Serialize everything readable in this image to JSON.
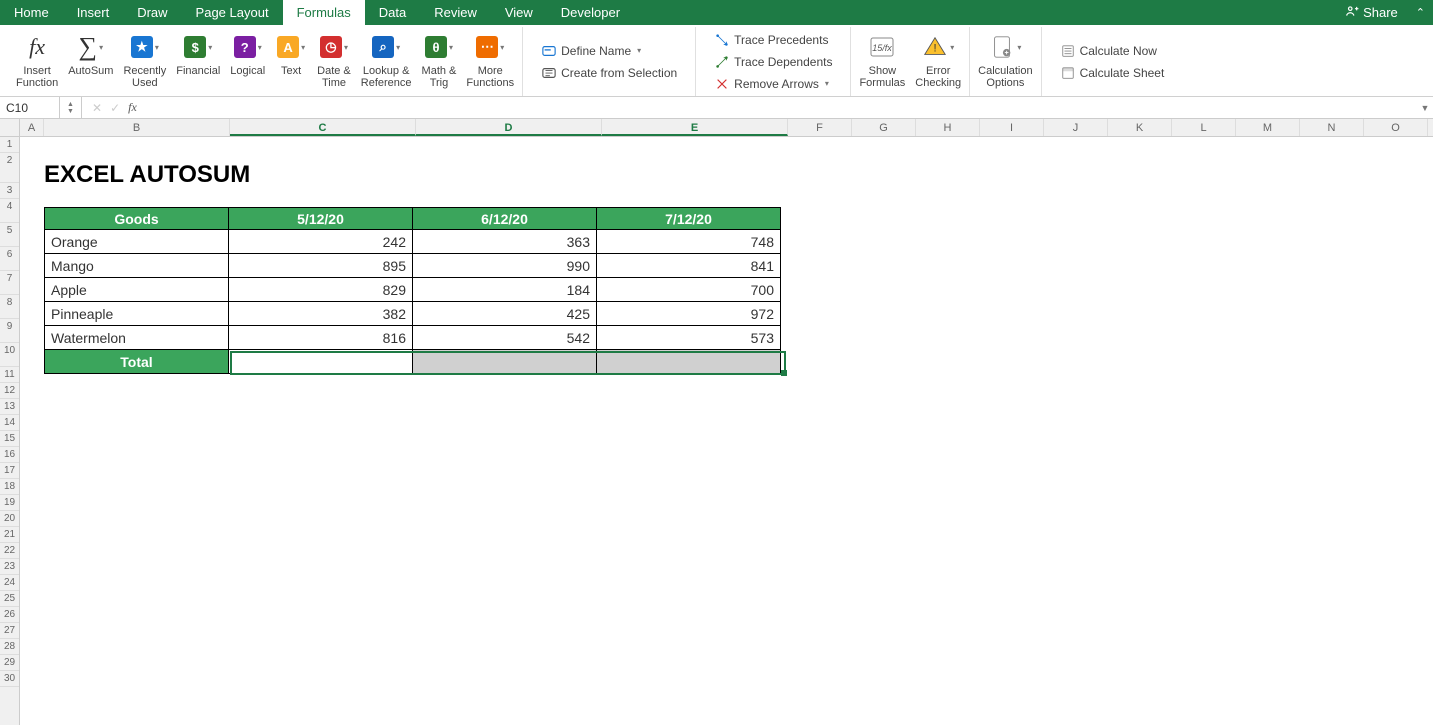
{
  "menu": {
    "tabs": [
      "Home",
      "Insert",
      "Draw",
      "Page Layout",
      "Formulas",
      "Data",
      "Review",
      "View",
      "Developer"
    ],
    "active": 4,
    "share": "Share"
  },
  "ribbon": {
    "insert_function": "Insert\nFunction",
    "autosum": "AutoSum",
    "recently": "Recently\nUsed",
    "financial": "Financial",
    "logical": "Logical",
    "text": "Text",
    "datetime": "Date &\nTime",
    "lookup": "Lookup &\nReference",
    "math": "Math &\nTrig",
    "more": "More\nFunctions",
    "define_name": "Define Name",
    "create_sel": "Create from Selection",
    "trace_prec": "Trace Precedents",
    "trace_dep": "Trace Dependents",
    "remove_arrows": "Remove Arrows",
    "show_formulas": "Show\nFormulas",
    "error_check": "Error\nChecking",
    "calc_options": "Calculation\nOptions",
    "calc_now": "Calculate Now",
    "calc_sheet": "Calculate Sheet"
  },
  "namebox": "C10",
  "cols": [
    "A",
    "B",
    "C",
    "D",
    "E",
    "F",
    "G",
    "H",
    "I",
    "J",
    "K",
    "L",
    "M",
    "N",
    "O"
  ],
  "selectedCols": [
    "C",
    "D",
    "E"
  ],
  "rows": 30,
  "sheet": {
    "title": "EXCEL AUTOSUM",
    "headers": [
      "Goods",
      "5/12/20",
      "6/12/20",
      "7/12/20"
    ],
    "data": [
      {
        "g": "Orange",
        "c": 242,
        "d": 363,
        "e": 748
      },
      {
        "g": "Mango",
        "c": 895,
        "d": 990,
        "e": 841
      },
      {
        "g": "Apple",
        "c": 829,
        "d": 184,
        "e": 700
      },
      {
        "g": "Pinneaple",
        "c": 382,
        "d": 425,
        "e": 972
      },
      {
        "g": "Watermelon",
        "c": 816,
        "d": 542,
        "e": 573
      }
    ],
    "total_label": "Total"
  }
}
